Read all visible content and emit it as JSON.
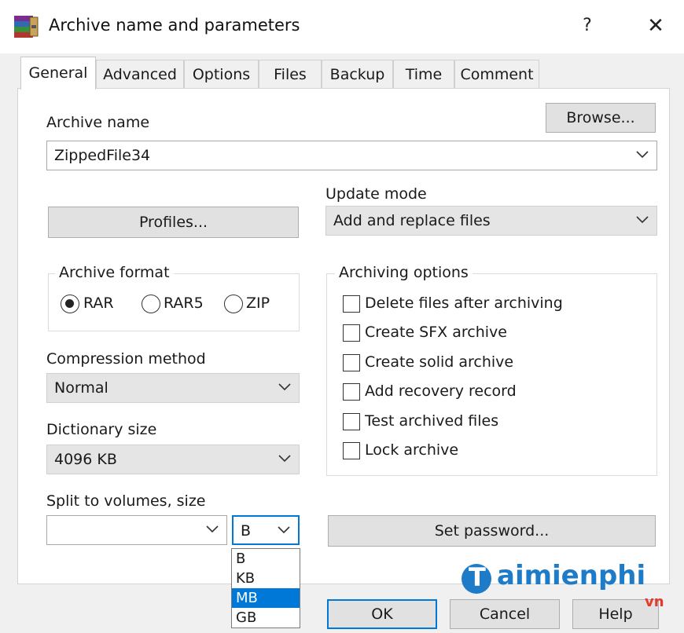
{
  "window": {
    "title": "Archive name and parameters",
    "help_label": "?",
    "close_label": "✕",
    "icon": "winrar-books-icon"
  },
  "tabs": [
    {
      "label": "General",
      "active": true
    },
    {
      "label": "Advanced"
    },
    {
      "label": "Options"
    },
    {
      "label": "Files"
    },
    {
      "label": "Backup"
    },
    {
      "label": "Time"
    },
    {
      "label": "Comment"
    }
  ],
  "general": {
    "archive_name_label": "Archive name",
    "browse_label": "Browse...",
    "archive_name_value": "ZippedFile34",
    "update_mode_label": "Update mode",
    "update_mode_value": "Add and replace files",
    "profiles_label": "Profiles...",
    "archive_format": {
      "title": "Archive format",
      "options": [
        "RAR",
        "RAR5",
        "ZIP"
      ],
      "selected": "RAR"
    },
    "archiving_options": {
      "title": "Archiving options",
      "items": [
        {
          "label": "Delete files after archiving",
          "checked": false
        },
        {
          "label": "Create SFX archive",
          "checked": false
        },
        {
          "label": "Create solid archive",
          "checked": false
        },
        {
          "label": "Add recovery record",
          "checked": false
        },
        {
          "label": "Test archived files",
          "checked": false
        },
        {
          "label": "Lock archive",
          "checked": false
        }
      ]
    },
    "compression_method_label": "Compression method",
    "compression_method_value": "Normal",
    "dictionary_size_label": "Dictionary size",
    "dictionary_size_value": "4096 KB",
    "split_label": "Split to volumes, size",
    "split_value": "",
    "split_unit_value": "B",
    "split_unit_options": [
      "B",
      "KB",
      "MB",
      "GB"
    ],
    "split_unit_highlighted": "MB",
    "set_password_label": "Set password..."
  },
  "footer": {
    "ok_label": "OK",
    "cancel_label": "Cancel",
    "help_label": "Help"
  },
  "watermark": {
    "brand_initial": "T",
    "brand_text": "aimienphi",
    "suffix": "vn"
  },
  "colors": {
    "selection": "#0078d7",
    "watermark_blue": "#1e7bc8",
    "watermark_red": "#e23b2e"
  }
}
